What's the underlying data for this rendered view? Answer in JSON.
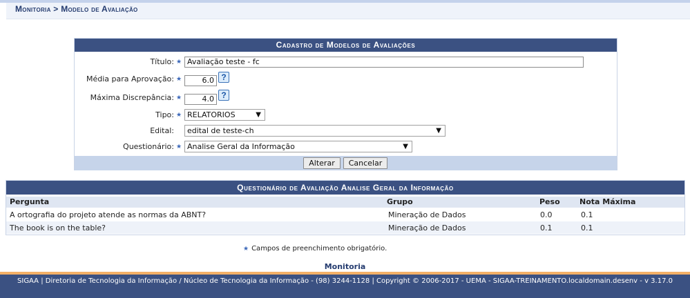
{
  "breadcrumb": {
    "text": "Monitoria > Modelo de Avaliação"
  },
  "form": {
    "caption": "Cadastro de Modelos de Avaliações",
    "titulo_label": "Título:",
    "titulo_value": "Avaliação teste - fc",
    "media_label": "Média para Aprovação:",
    "media_value": "6.0",
    "maxima_label": "Máxima Discrepância:",
    "maxima_value": "4.0",
    "tipo_label": "Tipo:",
    "tipo_value": "RELATORIOS",
    "edital_label": "Edital:",
    "edital_value": "edital de teste-ch",
    "questionario_label": "Questionário:",
    "questionario_value": "Analise Geral da Informação",
    "help_glyph": "?",
    "required_glyph": "★",
    "dropdown_glyph": "▼",
    "alterar_label": "Alterar",
    "cancelar_label": "Cancelar"
  },
  "questionnaire": {
    "caption": "Questionário de Avaliação Analise Geral da Informação",
    "headers": {
      "pergunta": "Pergunta",
      "grupo": "Grupo",
      "peso": "Peso",
      "nota": "Nota Máxima"
    },
    "rows": [
      {
        "pergunta": "A ortografia do projeto atende as normas da ABNT?",
        "grupo": "Mineração de Dados",
        "peso": "0.0",
        "nota": "0.1"
      },
      {
        "pergunta": "The book is on the table?",
        "grupo": "Mineração de Dados",
        "peso": "0.1",
        "nota": "0.1"
      }
    ]
  },
  "legend": {
    "star": "★",
    "text": "Campos de preenchimento obrigatório."
  },
  "footer": {
    "link": "Monitoria",
    "text": "SIGAA | Diretoria de Tecnologia da Informação / Núcleo de Tecnologia da Informação - (98) 3244-1128 | Copyright © 2006-2017 - UEMA - SIGAA-TREINAMENTO.localdomain.desenv - v 3.17.0"
  },
  "colors": {
    "header_blue": "#3b5182",
    "accent_orange": "#f3b067",
    "required_star": "#3a66b8"
  }
}
